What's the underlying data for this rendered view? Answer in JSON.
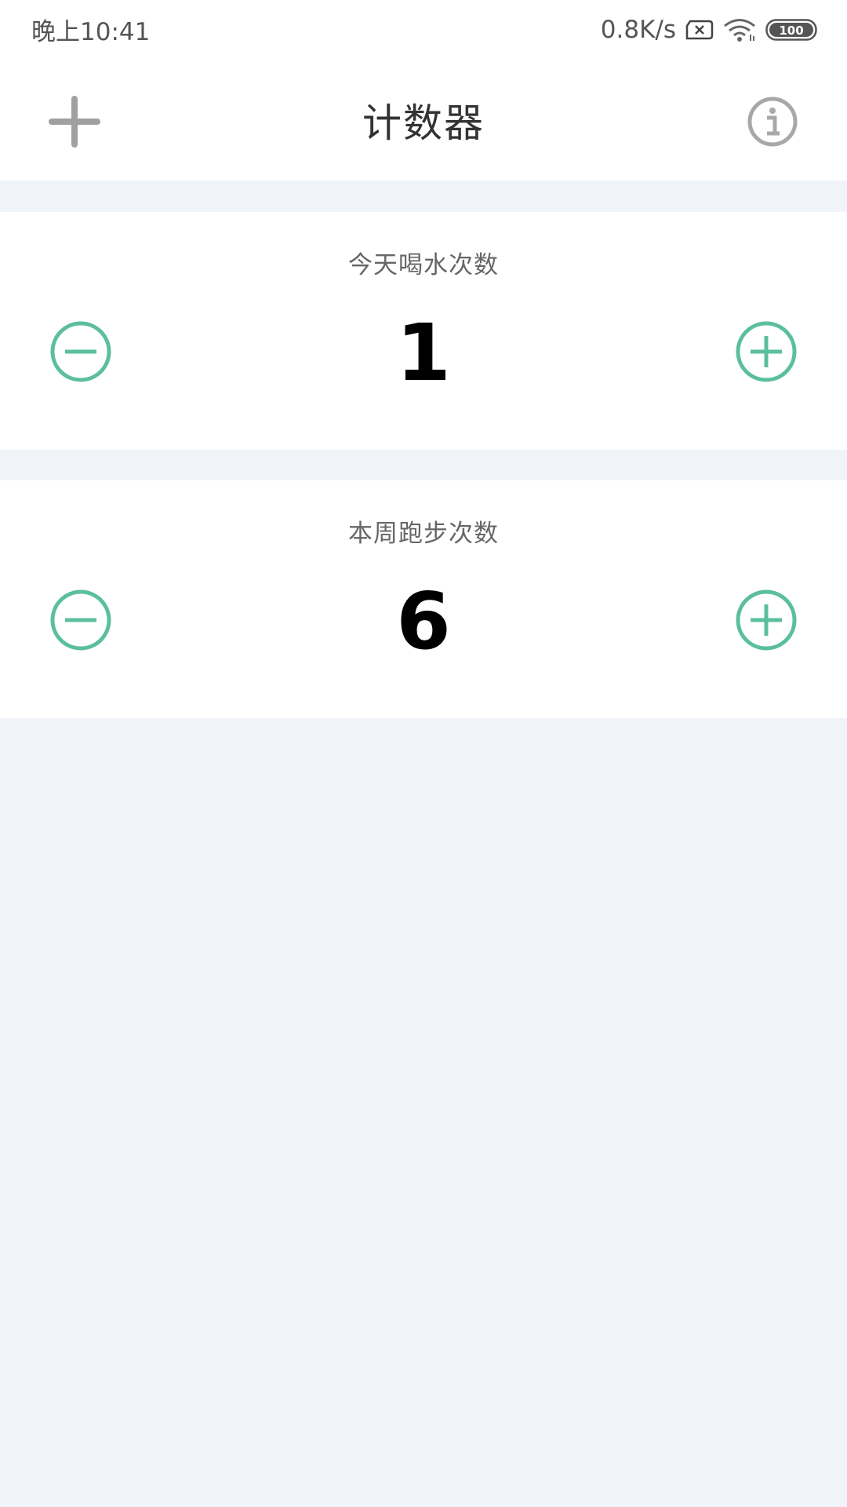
{
  "status_bar": {
    "time": "晚上10:41",
    "network_speed": "0.8K/s",
    "battery": "100",
    "icons": [
      "sim-blocked-icon",
      "wifi-icon",
      "battery-icon"
    ]
  },
  "header": {
    "title": "计数器",
    "left_icon": "plus-icon",
    "right_icon": "info-icon"
  },
  "counters": [
    {
      "label": "今天喝水次数",
      "value": "1"
    },
    {
      "label": "本周跑步次数",
      "value": "6"
    }
  ],
  "colors": {
    "accent": "#5bbf9c",
    "background": "#f0f3f8",
    "header_icon": "#a0a0a0"
  }
}
